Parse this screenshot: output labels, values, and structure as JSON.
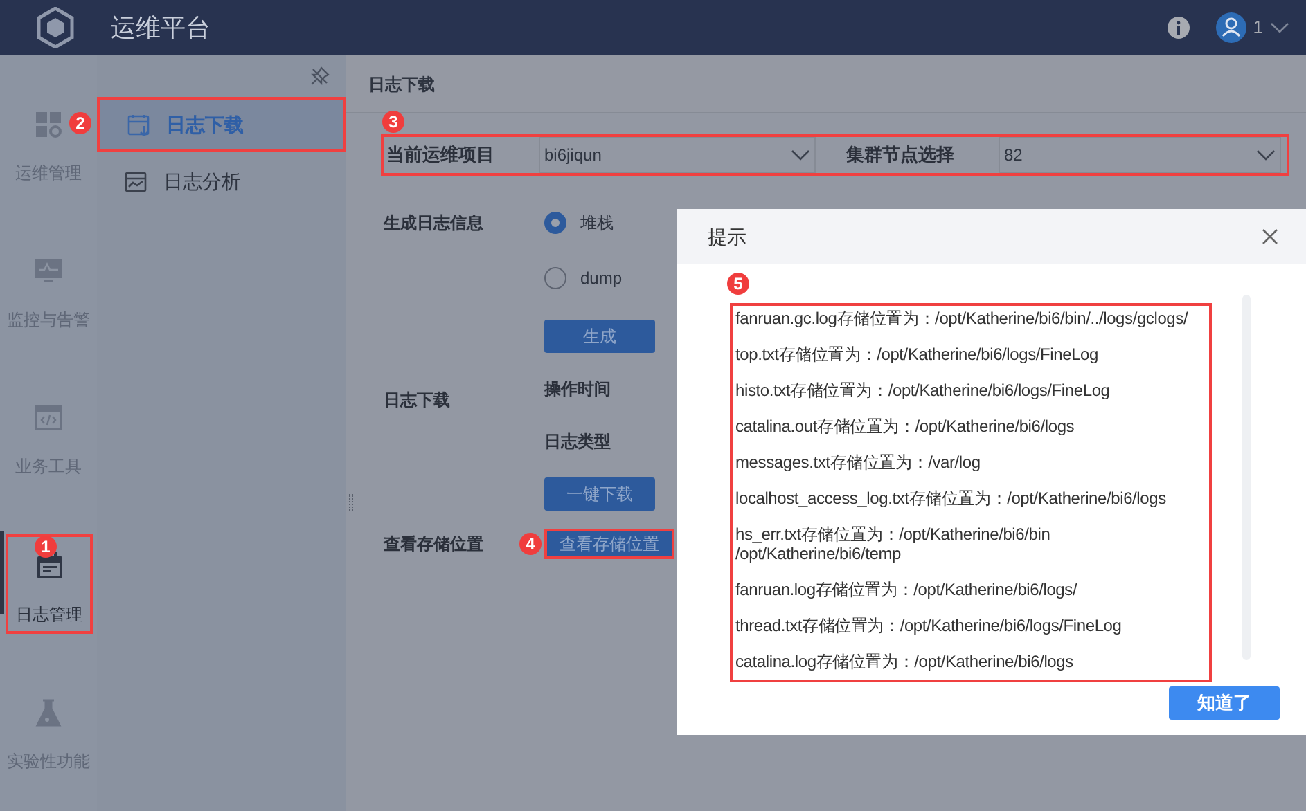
{
  "header": {
    "title": "运维平台",
    "user": "1"
  },
  "rail": [
    {
      "label": "运维管理",
      "kind": "grid",
      "selected": false
    },
    {
      "label": "监控与告警",
      "kind": "monitor",
      "selected": false
    },
    {
      "label": "业务工具",
      "kind": "code",
      "selected": false
    },
    {
      "label": "日志管理",
      "kind": "calendar",
      "selected": true,
      "callout": "1"
    },
    {
      "label": "实验性功能",
      "kind": "flask",
      "selected": false
    }
  ],
  "submenu": [
    {
      "label": "日志下载",
      "kind": "download",
      "selected": true,
      "callout": "2"
    },
    {
      "label": "日志分析",
      "kind": "chart",
      "selected": false
    }
  ],
  "page_title": "日志下载",
  "selectors": {
    "callout": "3",
    "items": [
      {
        "label": "当前运维项目",
        "value": "bi6jiqun"
      },
      {
        "label": "集群节点选择",
        "value": "82"
      }
    ]
  },
  "generate": {
    "label": "生成日志信息",
    "options": [
      {
        "label": "堆栈",
        "selected": true
      },
      {
        "label": "dump",
        "selected": false
      }
    ],
    "button": "生成"
  },
  "download": {
    "label": "日志下载",
    "fields": [
      "操作时间",
      "日志类型"
    ],
    "button": "一键下载"
  },
  "storage": {
    "label": "查看存储位置",
    "button": "查看存储位置",
    "callout": "4"
  },
  "dialog": {
    "title": "提示",
    "callout": "5",
    "button": "知道了",
    "lines": [
      "fanruan.gc.log存储位置为：/opt/Katherine/bi6/bin/../logs/gclogs/",
      "top.txt存储位置为：/opt/Katherine/bi6/logs/FineLog",
      "histo.txt存储位置为：/opt/Katherine/bi6/logs/FineLog",
      "catalina.out存储位置为：/opt/Katherine/bi6/logs",
      "messages.txt存储位置为：/var/log",
      "localhost_access_log.txt存储位置为：/opt/Katherine/bi6/logs",
      "hs_err.txt存储位置为：/opt/Katherine/bi6/bin\n/opt/Katherine/bi6/temp",
      "fanruan.log存储位置为：/opt/Katherine/bi6/logs/",
      "thread.txt存储位置为：/opt/Katherine/bi6/logs/FineLog",
      "catalina.log存储位置为：/opt/Katherine/bi6/logs"
    ]
  }
}
